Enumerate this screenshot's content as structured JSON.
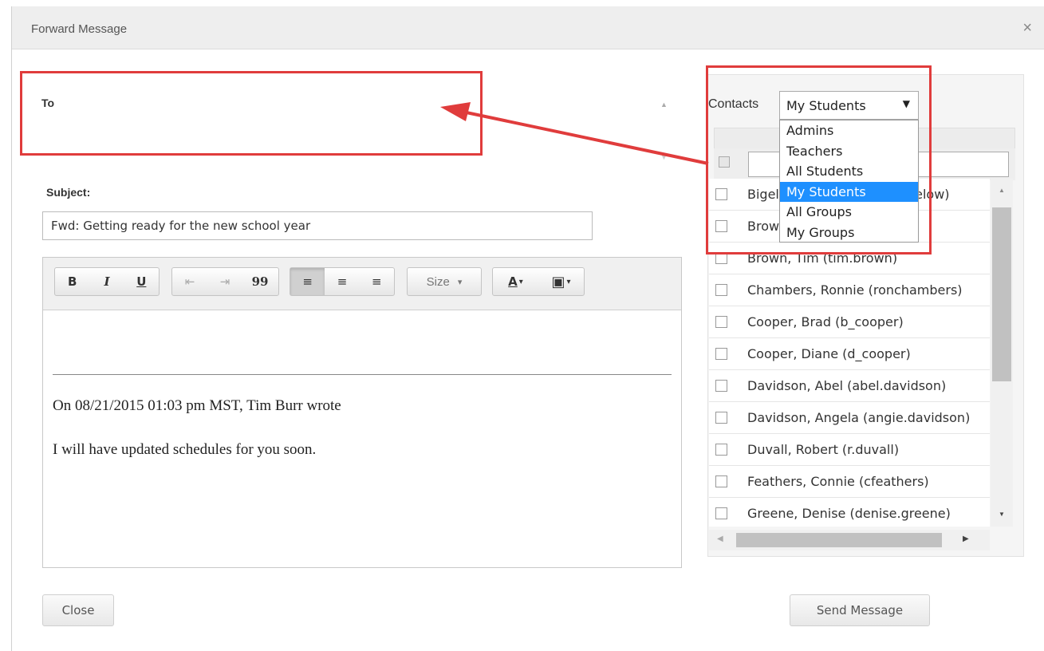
{
  "window": {
    "title": "Forward Message",
    "close_glyph": "×"
  },
  "to": {
    "label": "To"
  },
  "subject": {
    "label": "Subject:",
    "value": "Fwd: Getting ready for the new school year"
  },
  "editor": {
    "toolbar": {
      "bold": "B",
      "italic": "I",
      "underline": "U",
      "outdent": "⇤",
      "indent": "⇥",
      "blockquote": "99",
      "align_left": "≡",
      "align_center": "≡",
      "align_right": "≡",
      "size": "Size",
      "dropdown_caret": "▾",
      "font_color": "A",
      "bg_color": "▣"
    },
    "quote_header": "On 08/21/2015 01:03 pm MST, Tim Burr wrote",
    "quote_body": "I will have updated schedules for you soon."
  },
  "contacts": {
    "label": "Contacts",
    "selected": "My Students",
    "caret": "▼",
    "options": [
      "Admins",
      "Teachers",
      "All Students",
      "My Students",
      "All Groups",
      "My Groups"
    ],
    "list": [
      "Bigelow, Bryan (bryan_bigelow)",
      "Brown, Amy (amy.brown)",
      "Brown, Tim (tim.brown)",
      "Chambers, Ronnie (ronchambers)",
      "Cooper, Brad (b_cooper)",
      "Cooper, Diane (d_cooper)",
      "Davidson, Abel (abel.davidson)",
      "Davidson, Angela (angie.davidson)",
      "Duvall, Robert (r.duvall)",
      "Feathers, Connie (cfeathers)",
      "Greene, Denise (denise.greene)"
    ]
  },
  "scroll_glyphs": {
    "up": "▲",
    "down": "▼",
    "left": "◀",
    "right": "▶"
  },
  "buttons": {
    "close": "Close",
    "send": "Send Message"
  },
  "colors": {
    "highlight": "#e03c3c",
    "selection": "#1e90ff"
  }
}
